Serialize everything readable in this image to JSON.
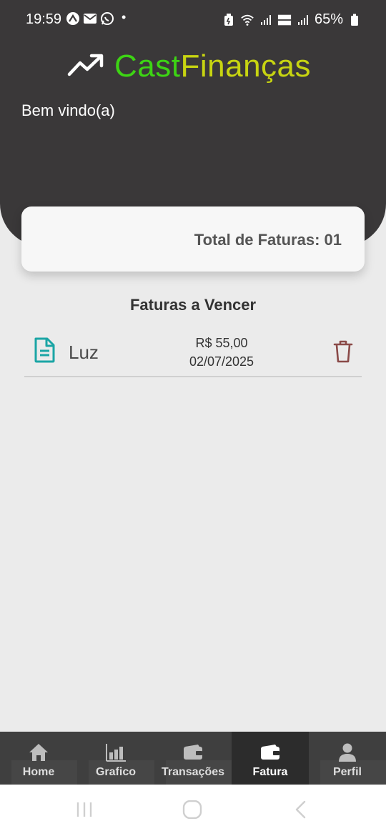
{
  "status_bar": {
    "time": "19:59",
    "dot": "•",
    "battery_percent": "65%",
    "left_icons": [
      "expo-icon",
      "mail-icon",
      "whatsapp-icon"
    ],
    "right_icons": [
      "battery-saver-icon",
      "wifi-icon",
      "signal-icon",
      "volte-icon",
      "signal-icon",
      "battery-icon"
    ]
  },
  "header": {
    "brand_part1": "Cast",
    "brand_part2": "Finanças",
    "brand_icon": "trending-up-icon",
    "welcome": "Bem vindo(a)",
    "colors": {
      "background": "#3a3839",
      "cast": "#3dd414",
      "financas": "#c7d411"
    }
  },
  "summary": {
    "total_label": "Total de Faturas: 01"
  },
  "invoices": {
    "title": "Faturas a Vencer",
    "items": [
      {
        "name": "Luz",
        "amount": "R$ 55,00",
        "date": "02/07/2025",
        "icon": "document-icon",
        "action_icon": "trash-icon"
      }
    ]
  },
  "bottom_nav": {
    "items": [
      {
        "label": "Home",
        "icon": "home-icon"
      },
      {
        "label": "Grafico",
        "icon": "bar-chart-icon"
      },
      {
        "label": "Transações",
        "icon": "wallet-icon"
      },
      {
        "label": "Fatura",
        "icon": "wallet-icon",
        "active": true
      },
      {
        "label": "Perfil",
        "icon": "person-icon"
      }
    ]
  },
  "system_nav": {
    "buttons": [
      "recent-apps-icon",
      "home-circle-icon",
      "back-icon"
    ]
  }
}
